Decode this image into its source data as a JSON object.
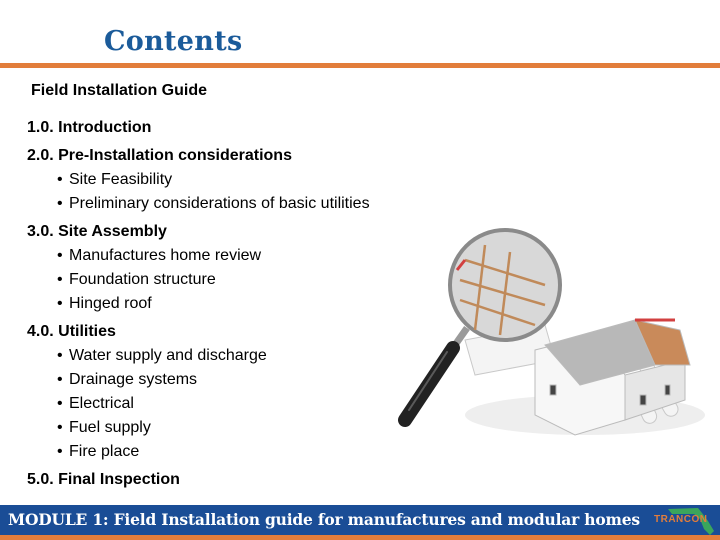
{
  "header": {
    "title": "Contents",
    "subtitle": "Field Installation Guide"
  },
  "toc": {
    "sections": [
      {
        "label": "1.0. Introduction",
        "items": []
      },
      {
        "label": "2.0. Pre-Installation considerations",
        "items": [
          "Site Feasibility",
          "Preliminary considerations of basic utilities"
        ]
      },
      {
        "label": "3.0. Site Assembly",
        "items": [
          "Manufactures home review",
          "Foundation structure",
          "Hinged roof"
        ]
      },
      {
        "label": "4.0. Utilities",
        "items": [
          "Water supply and discharge",
          "Drainage systems",
          "Electrical",
          "Fuel supply",
          "Fire place"
        ]
      },
      {
        "label": "5.0. Final Inspection",
        "items": []
      }
    ],
    "bullet": "•"
  },
  "illustration": {
    "icon": "magnifying-glass-house-icon"
  },
  "footer": {
    "text": "MODULE 1: Field Installation guide for manufactures and modular homes",
    "logo_text": "TRANCON"
  },
  "colors": {
    "title": "#1b5b9a",
    "accent_orange": "#e27d3b",
    "footer_blue": "#1a4d96",
    "logo_green": "#3aa55c"
  }
}
